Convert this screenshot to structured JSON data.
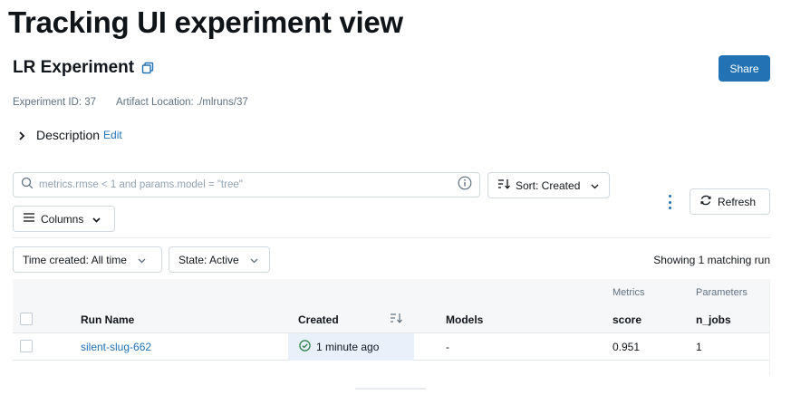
{
  "page": {
    "title": "Tracking UI experiment view"
  },
  "experiment": {
    "name": "LR Experiment",
    "id_label": "Experiment ID: 37",
    "artifact_label": "Artifact Location: ./mlruns/37",
    "description_label": "Description",
    "edit_label": "Edit",
    "share_label": "Share"
  },
  "toolbar": {
    "search_placeholder": "metrics.rmse < 1 and params.model = \"tree\"",
    "sort_label": "Sort: Created",
    "columns_label": "Columns",
    "refresh_label": "Refresh",
    "time_filter_label": "Time created: All time",
    "state_filter_label": "State: Active",
    "showing_label": "Showing 1 matching run"
  },
  "table": {
    "groups": {
      "metrics": "Metrics",
      "parameters": "Parameters"
    },
    "headers": {
      "run_name": "Run Name",
      "created": "Created",
      "models": "Models",
      "score": "score",
      "n_jobs": "n_jobs"
    },
    "rows": [
      {
        "run_name": "silent-slug-662",
        "created": "1 minute ago",
        "models": "-",
        "score": "0.951",
        "n_jobs": "1"
      }
    ]
  },
  "colors": {
    "accent": "#2272b4",
    "success": "#277c43",
    "header_bg": "#f5f7f9",
    "selected_bg": "#e8f1f9"
  }
}
